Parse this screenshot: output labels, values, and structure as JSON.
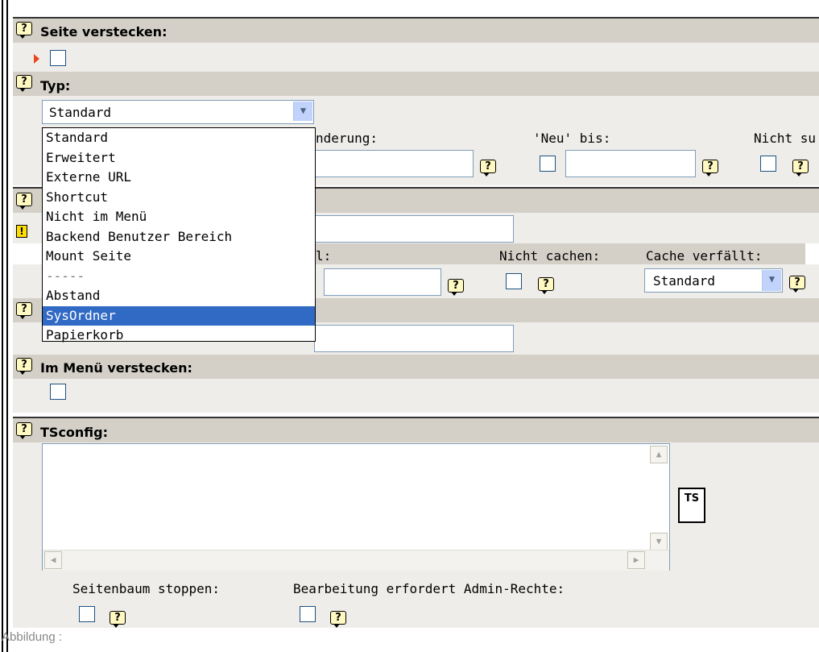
{
  "sections": {
    "hide_page": {
      "label": "Seite verstecken:"
    },
    "type": {
      "label": "Typ:",
      "selected": "Standard",
      "options": [
        "Standard",
        "Erweitert",
        "Externe URL",
        "Shortcut",
        "Nicht im Menü",
        "Backend Benutzer Bereich",
        "Mount Seite",
        "-----",
        "Abstand",
        "SysOrdner",
        "Papierkorb"
      ],
      "highlighted": "SysOrdner"
    },
    "dates": {
      "last_change_label_partial": "nderung:",
      "new_until_label": "'Neu' bis:",
      "not_search_label_partial": "Nicht su"
    },
    "cache": {
      "partial_label": "l:",
      "no_cache_label": "Nicht cachen:",
      "cache_expires_label": "Cache verfällt:",
      "cache_expires_value": "Standard"
    },
    "hide_in_menu": {
      "label": "Im Menü verstecken:"
    },
    "tsconfig": {
      "label": "TSconfig:",
      "button": "TS"
    },
    "bottom": {
      "stop_tree_label": "Seitenbaum stoppen:",
      "admin_only_label": "Bearbeitung erfordert Admin-Rechte:"
    }
  },
  "icons": {
    "help": "?",
    "warning": "!"
  },
  "caption": "Abbildung :"
}
